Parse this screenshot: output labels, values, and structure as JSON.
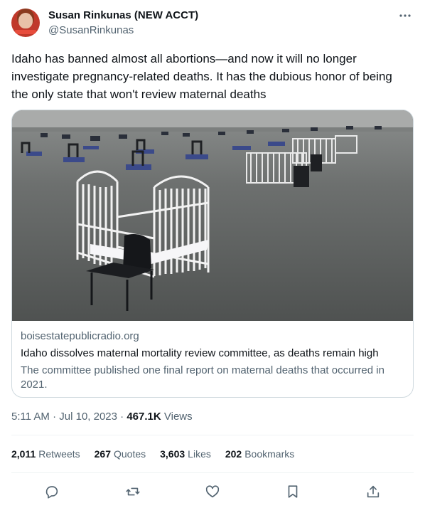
{
  "author": {
    "display_name": "Susan Rinkunas (NEW ACCT)",
    "handle": "@SusanRinkunas",
    "avatar_icon": "profile-photo"
  },
  "more_icon": "more-horizontal-icon",
  "tweet": {
    "text": "Idaho has banned almost all abortions—and now it will no longer investigate pregnancy-related deaths. It has the dubious honor of being the only state that won't review maternal deaths"
  },
  "card": {
    "image_description_icon": "photo-of-empty-cribs-and-chairs-in-convention-hall",
    "domain": "boisestatepublicradio.org",
    "title": "Idaho dissolves maternal mortality review committee, as deaths remain high",
    "description": "The committee published one final report on maternal deaths that occurred in 2021."
  },
  "meta": {
    "time": "5:11 AM",
    "separator": "·",
    "date": "Jul 10, 2023",
    "views_count": "467.1K",
    "views_label": "Views"
  },
  "stats": [
    {
      "count": "2,011",
      "label": "Retweets"
    },
    {
      "count": "267",
      "label": "Quotes"
    },
    {
      "count": "3,603",
      "label": "Likes"
    },
    {
      "count": "202",
      "label": "Bookmarks"
    }
  ],
  "actions": {
    "reply_icon": "reply-icon",
    "retweet_icon": "retweet-icon",
    "like_icon": "like-icon",
    "bookmark_icon": "bookmark-icon",
    "share_icon": "share-icon"
  },
  "colors": {
    "text_primary": "#0f1419",
    "text_secondary": "#536471",
    "border": "#cfd9de"
  }
}
